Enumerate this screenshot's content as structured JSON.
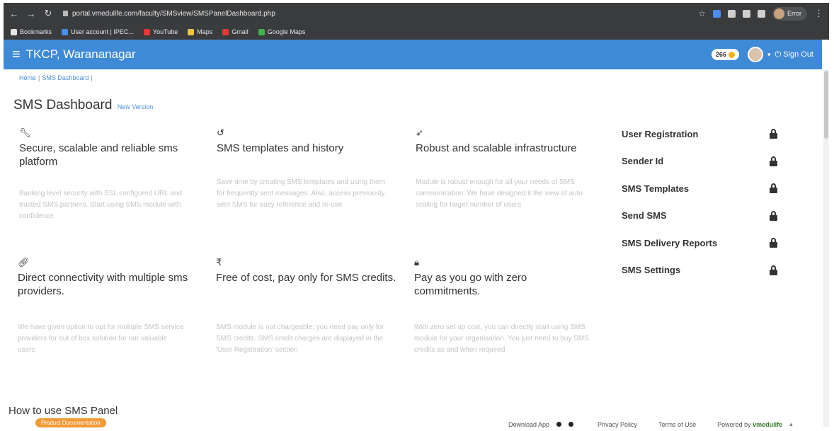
{
  "browser": {
    "url": "portal.vmedulife.com/faculty/SMSview/SMSPanelDashboard.php",
    "profile_label": "Error",
    "bookmarks": [
      {
        "label": "Bookmarks",
        "color": "#e6e6e6"
      },
      {
        "label": "User account | IPEC...",
        "color": "#4a8ef0"
      },
      {
        "label": "YouTube",
        "color": "#e53935"
      },
      {
        "label": "Maps",
        "color": "#f2c14e"
      },
      {
        "label": "Gmail",
        "color": "#e53935"
      },
      {
        "label": "Google Maps",
        "color": "#3fb24f"
      }
    ]
  },
  "header": {
    "title": "TKCP, Warananagar",
    "credits": "266",
    "signout": "Sign Out",
    "color": "#3f8ad6"
  },
  "breadcrumb": {
    "home": "Home",
    "current": "SMS Dashboard"
  },
  "page": {
    "title": "SMS Dashboard",
    "version_link": "New Version"
  },
  "features": [
    {
      "icon": "wrench-icon",
      "heading": "Secure, scalable and reliable sms platform",
      "description": "Banking level security with SSL configured URL and trusted SMS partners. Start using SMS module with confidence"
    },
    {
      "icon": "history-icon",
      "heading": "SMS templates and history",
      "description": "Save time by creating SMS templates and using them for frequently sent messages. Also, access previously sent SMS for easy reference and re-use"
    },
    {
      "icon": "rocket-icon",
      "heading": "Robust and scalable infrastructure",
      "description": "Module is robust enough for all your needs of SMS communication. We have designed it the view of auto scaling for larger number of users"
    },
    {
      "icon": "link-icon",
      "heading": "Direct connectivity with multiple sms providers.",
      "description": "We have given option to opt for multiple SMS service providers for out of box solution for our valuable users"
    },
    {
      "icon": "rupee-icon",
      "heading": "Free of cost, pay only for SMS credits.",
      "description": "SMS module is not chargeable; you need pay only for SMS credits. SMS credit charges are displayed in the 'User Registration' section"
    },
    {
      "icon": "lock-icon",
      "heading": "Pay as you go with zero commitments.",
      "description": "With zero set up cost, you can directly start using SMS module for your organisation. You just need to buy SMS credits as and when required"
    }
  ],
  "side_menu": [
    {
      "label": "User Registration"
    },
    {
      "label": "Sender Id"
    },
    {
      "label": "SMS Templates"
    },
    {
      "label": "Send SMS"
    },
    {
      "label": "SMS Delivery Reports"
    },
    {
      "label": "SMS Settings"
    }
  ],
  "bottom": {
    "howto": "How to use SMS Panel",
    "doc_badge": "Product Documentation"
  },
  "footer": {
    "download": "Download App",
    "privacy": "Privacy Policy",
    "terms": "Terms of Use",
    "powered": "Powered by",
    "brand": "vmedulife"
  }
}
